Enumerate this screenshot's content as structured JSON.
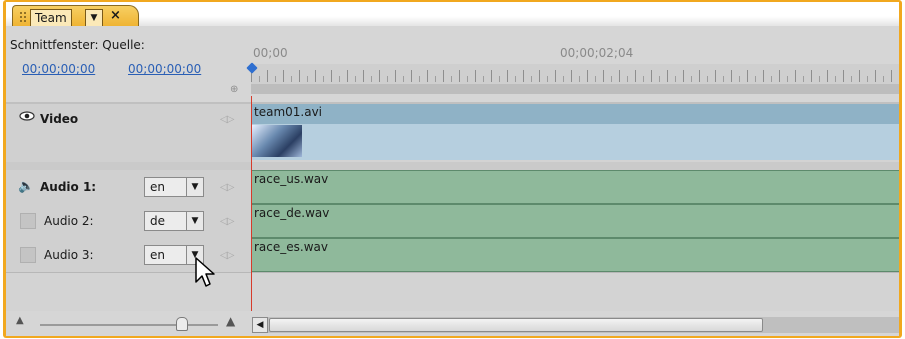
{
  "panel_tab": {
    "title": "Team",
    "menu_glyph": "▼",
    "close_glyph": "×"
  },
  "header": {
    "sequence_label": "Schnittfenster: Quelle:",
    "timecode_left": "00;00;00;00",
    "timecode_right": "00;00;00;00"
  },
  "ruler": {
    "label_start": "00;00",
    "label_mid": "00;00;02;04"
  },
  "tracks": {
    "video": {
      "name": "Video",
      "clip": "team01.avi"
    },
    "audio": [
      {
        "name": "Audio 1:",
        "lang": "en",
        "clip": "race_us.wav"
      },
      {
        "name": "Audio 2:",
        "lang": "de",
        "clip": "race_de.wav"
      },
      {
        "name": "Audio 3:",
        "lang": "en",
        "clip": "race_es.wav"
      }
    ]
  },
  "glyphs": {
    "dropdown": "▼",
    "kf_nav": "◁▷",
    "scroll_left": "◀"
  },
  "icons": [
    "eye-icon",
    "speaker-icon",
    "snap-icon",
    "zoom-out-icon",
    "zoom-in-icon",
    "mouse-cursor-icon"
  ],
  "colors": {
    "panel_border": "#f1a81f",
    "audio_clip": "#8fb99b",
    "video_clip_top": "#8fb2c6",
    "video_clip_bottom": "#b6cfdf",
    "timecode_link": "#2a5fb5",
    "playhead": "#d63b2b"
  }
}
